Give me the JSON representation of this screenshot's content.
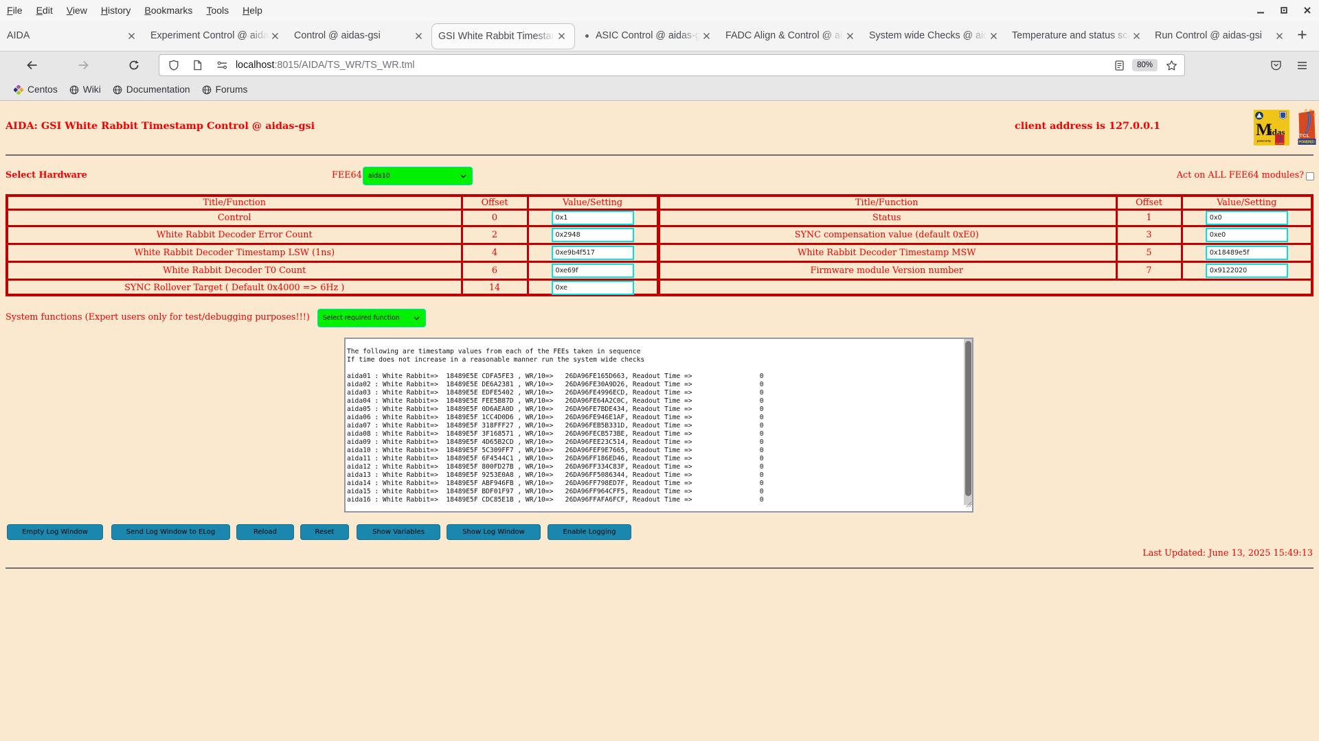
{
  "browser": {
    "menu": [
      "File",
      "Edit",
      "View",
      "History",
      "Bookmarks",
      "Tools",
      "Help"
    ],
    "tabs": [
      {
        "title": "AIDA"
      },
      {
        "title": "Experiment Control @ aidas"
      },
      {
        "title": "Control @ aidas-gsi"
      },
      {
        "title": "GSI White Rabbit Timestamp"
      },
      {
        "title": "ASIC Control @ aidas-gs"
      },
      {
        "title": "FADC Align & Control @ aid"
      },
      {
        "title": "System wide Checks @ aida"
      },
      {
        "title": "Temperature and status scan"
      },
      {
        "title": "Run Control @ aidas-gsi"
      }
    ],
    "url": {
      "host": "localhost",
      "path": ":8015/AIDA/TS_WR/TS_WR.tml",
      "zoom": "80%"
    },
    "bookmarks": [
      "Centos",
      "Wiki",
      "Documentation",
      "Forums"
    ]
  },
  "page": {
    "title": "AIDA: GSI White Rabbit Timestamp Control @ aidas-gsi",
    "client_address": "client address is 127.0.0.1",
    "select_hardware_label": "Select Hardware",
    "fee64_label": "FEE64",
    "fee64_value": "aida10",
    "act_on_all_label": "Act on ALL FEE64 modules?",
    "registers": {
      "headers": [
        "Title/Function",
        "Offset",
        "Value/Setting"
      ],
      "left_rows": [
        {
          "title": "Control",
          "offset": "0",
          "value": "0x1"
        },
        {
          "title": "White Rabbit Decoder Error Count",
          "offset": "2",
          "value": "0x2948"
        },
        {
          "title": "White Rabbit Decoder Timestamp LSW (1ns)",
          "offset": "4",
          "value": "0xe9b4f517"
        },
        {
          "title": "White Rabbit Decoder T0 Count",
          "offset": "6",
          "value": "0xe69f"
        },
        {
          "title": "SYNC Rollover Target ( Default 0x4000 => 6Hz )",
          "offset": "14",
          "value": "0xe"
        }
      ],
      "right_rows": [
        {
          "title": "Status",
          "offset": "1",
          "value": "0x0"
        },
        {
          "title": "SYNC compensation value (default 0xE0)",
          "offset": "3",
          "value": "0xe0"
        },
        {
          "title": "White Rabbit Decoder Timestamp MSW",
          "offset": "5",
          "value": "0x18489e5f"
        },
        {
          "title": "Firmware module Version number",
          "offset": "7",
          "value": "0x9122020"
        }
      ]
    },
    "system_functions_label": "System functions (Expert users only for test/debugging purposes!!!)",
    "system_functions_value": "Select required function",
    "log_text": "\nThe following are timestamp values from each of the FEEs taken in sequence\nIf time does not increase in a reasonable manner run the system wide checks\n\naida01 : White Rabbit=>  18489E5E CDFA5FE3 , WR/10=>   26DA96FE165D663, Readout Time =>                 0\naida02 : White Rabbit=>  18489E5E DE6A2381 , WR/10=>   26DA96FE30A9D26, Readout Time =>                 0\naida03 : White Rabbit=>  18489E5E EDFE5402 , WR/10=>   26DA96FE4996ECD, Readout Time =>                 0\naida04 : White Rabbit=>  18489E5E FEE5B87D , WR/10=>   26DA96FE64A2C0C, Readout Time =>                 0\naida05 : White Rabbit=>  18489E5F 0D6AEA0D , WR/10=>   26DA96FE7BDE434, Readout Time =>                 0\naida06 : White Rabbit=>  18489E5F 1CC4D0D6 , WR/10=>   26DA96FE946E1AF, Readout Time =>                 0\naida07 : White Rabbit=>  18489E5F 318FFF27 , WR/10=>   26DA96FEB5B331D, Readout Time =>                 0\naida08 : White Rabbit=>  18489E5F 3F168571 , WR/10=>   26DA96FECB573BE, Readout Time =>                 0\naida09 : White Rabbit=>  18489E5F 4D65B2CD , WR/10=>   26DA96FEE23C514, Readout Time =>                 0\naida10 : White Rabbit=>  18489E5F 5C309FF7 , WR/10=>   26DA96FEF9E7665, Readout Time =>                 0\naida11 : White Rabbit=>  18489E5F 6F4544C1 , WR/10=>   26DA96FF186ED46, Readout Time =>                 0\naida12 : White Rabbit=>  18489E5F 800FD27B , WR/10=>   26DA96FF334C83F, Readout Time =>                 0\naida13 : White Rabbit=>  18489E5F 9253E0A8 , WR/10=>   26DA96FF5086344, Readout Time =>                 0\naida14 : White Rabbit=>  18489E5F ABF946FB , WR/10=>   26DA96FF798ED7F, Readout Time =>                 0\naida15 : White Rabbit=>  18489E5F BDF01F97 , WR/10=>   26DA96FF964CFF5, Readout Time =>                 0\naida16 : White Rabbit=>  18489E5F CDC85E1B , WR/10=>   26DA96FFAFA6FCF, Readout Time =>                 0",
    "buttons": [
      "Empty Log Window",
      "Send Log Window to ELog",
      "Reload",
      "Reset",
      "Show Variables",
      "Show Log Window",
      "Enable Logging"
    ],
    "last_updated": "Last Updated: June 13, 2025 15:49:13",
    "colors": {
      "page_background": "#fbe9cf",
      "red_text": "#f40000",
      "table_border": "#c00000",
      "input_border": "#00e2e2",
      "select_background": "#00f000",
      "button_background": "#1b87af"
    }
  }
}
